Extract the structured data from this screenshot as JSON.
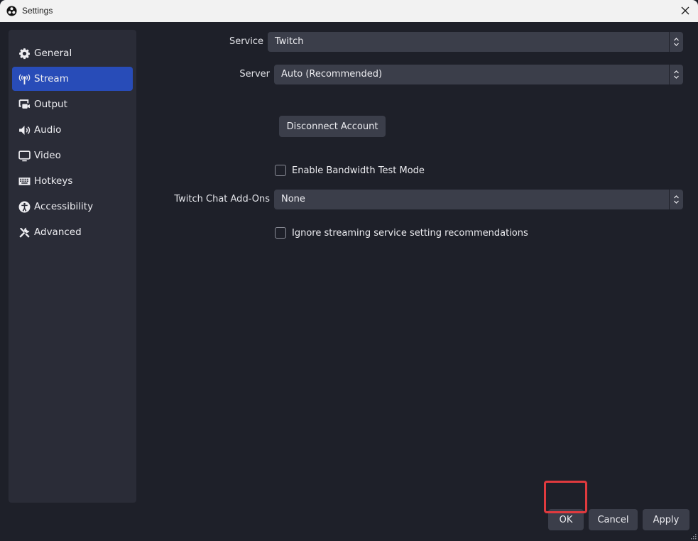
{
  "window": {
    "title": "Settings",
    "app_icon": "obs-logo-icon",
    "close_icon": "close-icon"
  },
  "sidebar": {
    "items": [
      {
        "label": "General",
        "icon": "gear-icon",
        "active": false
      },
      {
        "label": "Stream",
        "icon": "antenna-icon",
        "active": true
      },
      {
        "label": "Output",
        "icon": "output-icon",
        "active": false
      },
      {
        "label": "Audio",
        "icon": "speaker-icon",
        "active": false
      },
      {
        "label": "Video",
        "icon": "monitor-icon",
        "active": false
      },
      {
        "label": "Hotkeys",
        "icon": "keyboard-icon",
        "active": false
      },
      {
        "label": "Accessibility",
        "icon": "accessibility-icon",
        "active": false
      },
      {
        "label": "Advanced",
        "icon": "tools-icon",
        "active": false
      }
    ]
  },
  "stream": {
    "service": {
      "label": "Service",
      "value": "Twitch"
    },
    "server": {
      "label": "Server",
      "value": "Auto (Recommended)"
    },
    "disconnect_button": "Disconnect Account",
    "bandwidth_test": {
      "label": "Enable Bandwidth Test Mode",
      "checked": false
    },
    "chat_addons": {
      "label": "Twitch Chat Add-Ons",
      "value": "None"
    },
    "ignore_recommendations": {
      "label": "Ignore streaming service setting recommendations",
      "checked": false
    }
  },
  "footer": {
    "ok_label": "OK",
    "cancel_label": "Cancel",
    "apply_label": "Apply"
  },
  "colors": {
    "accent": "#284cb8",
    "highlight": "#e03a3e",
    "background": "#1e2029",
    "sidebar": "#2a2c37",
    "control": "#3b3e4a"
  }
}
